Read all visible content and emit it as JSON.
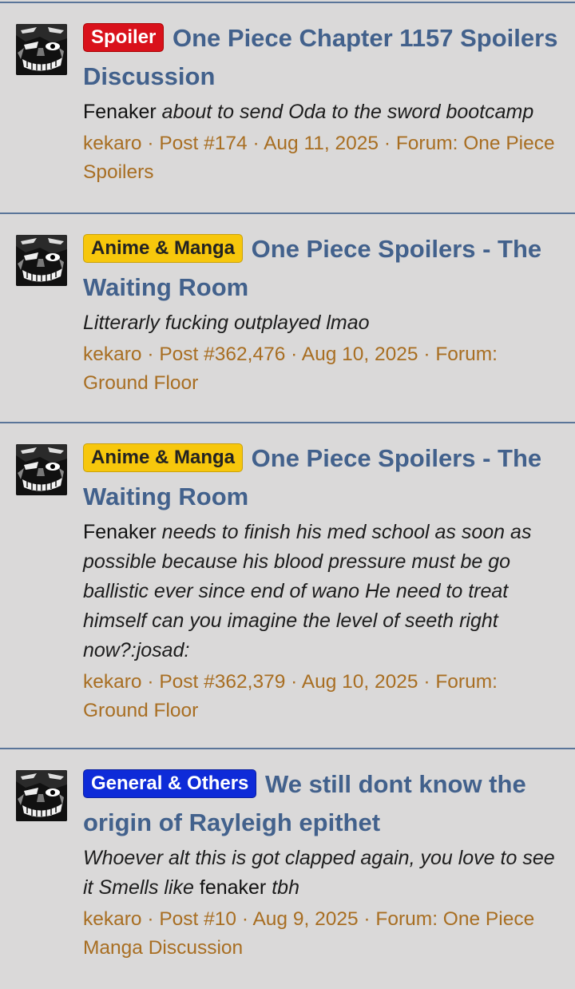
{
  "results": [
    {
      "prefix": "Spoiler",
      "title": "One Piece Chapter 1157 Spoilers Discussion",
      "snippet_user": "Fenaker",
      "snippet_text": "about to send Oda to the sword bootcamp",
      "meta_user": "kekaro",
      "meta_post": "Post #174",
      "meta_date": "Aug 11, 2025",
      "meta_forum": "Forum: One Piece Spoilers"
    },
    {
      "prefix": "Anime & Manga",
      "title": "One Piece Spoilers - The Waiting Room",
      "snippet_text": "Litterarly fucking outplayed lmao",
      "meta_user": "kekaro",
      "meta_post": "Post #362,476",
      "meta_date": "Aug 10, 2025",
      "meta_forum": "Forum: Ground Floor"
    },
    {
      "prefix": "Anime & Manga",
      "title": "One Piece Spoilers - The Waiting Room",
      "snippet_user": "Fenaker",
      "snippet_text": "needs to finish his med school as soon as possible because his blood pressure must be go ballistic ever since end of wano He need to treat himself can you imagine the level of seeth right now?:josad:",
      "meta_user": "kekaro",
      "meta_post": "Post #362,379",
      "meta_date": "Aug 10, 2025",
      "meta_forum": "Forum: Ground Floor"
    },
    {
      "prefix": "General & Others",
      "title": "We still dont know the origin of Rayleigh epithet",
      "snippet_text_before": "Whoever alt this is got clapped again, you love to see it Smells like",
      "snippet_user": "fenaker",
      "snippet_text_after": "tbh",
      "meta_user": "kekaro",
      "meta_post": "Post #10",
      "meta_date": "Aug 9, 2025",
      "meta_forum": "Forum: One Piece Manga Discussion"
    }
  ],
  "separator": " · ",
  "colors": {
    "background": "#dad9d9",
    "title": "#42618c",
    "meta": "#a86e22",
    "divider": "#5a7599",
    "prefix_spoiler": "#d9111b",
    "prefix_anime": "#f7c70c",
    "prefix_general": "#0e2bd8"
  }
}
